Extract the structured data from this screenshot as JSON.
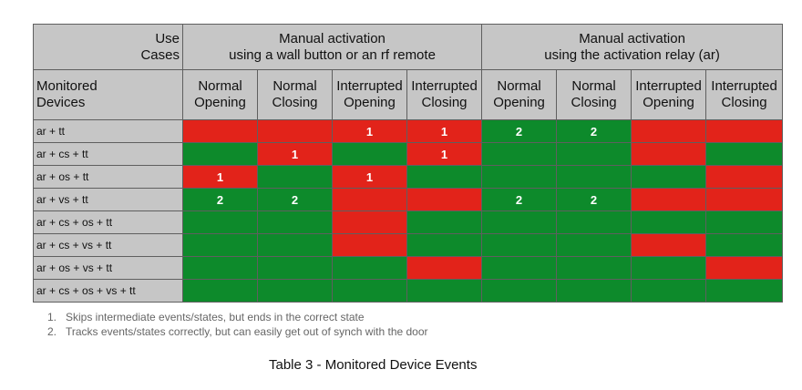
{
  "header": {
    "use_cases_line1": "Use",
    "use_cases_line2": "Cases",
    "group1_line1": "Manual activation",
    "group1_line2": "using a wall button or an rf remote",
    "group2_line1": "Manual activation",
    "group2_line2": "using the activation relay (ar)",
    "monitored_line1": "Monitored",
    "monitored_line2": "Devices",
    "columns": [
      {
        "line1": "Normal",
        "line2": "Opening"
      },
      {
        "line1": "Normal",
        "line2": "Closing"
      },
      {
        "line1": "Interrupted",
        "line2": "Opening"
      },
      {
        "line1": "Interrupted",
        "line2": "Closing"
      },
      {
        "line1": "Normal",
        "line2": "Opening"
      },
      {
        "line1": "Normal",
        "line2": "Closing"
      },
      {
        "line1": "Interrupted",
        "line2": "Opening"
      },
      {
        "line1": "Interrupted",
        "line2": "Closing"
      }
    ]
  },
  "colors": {
    "red": "#e2231a",
    "green": "#0d8a2b",
    "header": "#c6c6c6"
  },
  "rows": [
    {
      "label": "ar + tt",
      "cells": [
        {
          "s": "red",
          "t": ""
        },
        {
          "s": "red",
          "t": ""
        },
        {
          "s": "red",
          "t": "1"
        },
        {
          "s": "red",
          "t": "1"
        },
        {
          "s": "green",
          "t": "2"
        },
        {
          "s": "green",
          "t": "2"
        },
        {
          "s": "red",
          "t": ""
        },
        {
          "s": "red",
          "t": ""
        }
      ]
    },
    {
      "label": "ar + cs + tt",
      "cells": [
        {
          "s": "green",
          "t": ""
        },
        {
          "s": "red",
          "t": "1"
        },
        {
          "s": "green",
          "t": ""
        },
        {
          "s": "red",
          "t": "1"
        },
        {
          "s": "green",
          "t": ""
        },
        {
          "s": "green",
          "t": ""
        },
        {
          "s": "red",
          "t": ""
        },
        {
          "s": "green",
          "t": ""
        }
      ]
    },
    {
      "label": "ar + os + tt",
      "cells": [
        {
          "s": "red",
          "t": "1"
        },
        {
          "s": "green",
          "t": ""
        },
        {
          "s": "red",
          "t": "1"
        },
        {
          "s": "green",
          "t": ""
        },
        {
          "s": "green",
          "t": ""
        },
        {
          "s": "green",
          "t": ""
        },
        {
          "s": "green",
          "t": ""
        },
        {
          "s": "red",
          "t": ""
        }
      ]
    },
    {
      "label": "ar + vs + tt",
      "cells": [
        {
          "s": "green",
          "t": "2"
        },
        {
          "s": "green",
          "t": "2"
        },
        {
          "s": "red",
          "t": ""
        },
        {
          "s": "red",
          "t": ""
        },
        {
          "s": "green",
          "t": "2"
        },
        {
          "s": "green",
          "t": "2"
        },
        {
          "s": "red",
          "t": ""
        },
        {
          "s": "red",
          "t": ""
        }
      ]
    },
    {
      "label": "ar + cs + os + tt",
      "cells": [
        {
          "s": "green",
          "t": ""
        },
        {
          "s": "green",
          "t": ""
        },
        {
          "s": "red",
          "t": ""
        },
        {
          "s": "green",
          "t": ""
        },
        {
          "s": "green",
          "t": ""
        },
        {
          "s": "green",
          "t": ""
        },
        {
          "s": "green",
          "t": ""
        },
        {
          "s": "green",
          "t": ""
        }
      ]
    },
    {
      "label": "ar + cs + vs + tt",
      "cells": [
        {
          "s": "green",
          "t": ""
        },
        {
          "s": "green",
          "t": ""
        },
        {
          "s": "red",
          "t": ""
        },
        {
          "s": "green",
          "t": ""
        },
        {
          "s": "green",
          "t": ""
        },
        {
          "s": "green",
          "t": ""
        },
        {
          "s": "red",
          "t": ""
        },
        {
          "s": "green",
          "t": ""
        }
      ]
    },
    {
      "label": "ar + os + vs + tt",
      "cells": [
        {
          "s": "green",
          "t": ""
        },
        {
          "s": "green",
          "t": ""
        },
        {
          "s": "green",
          "t": ""
        },
        {
          "s": "red",
          "t": ""
        },
        {
          "s": "green",
          "t": ""
        },
        {
          "s": "green",
          "t": ""
        },
        {
          "s": "green",
          "t": ""
        },
        {
          "s": "red",
          "t": ""
        }
      ]
    },
    {
      "label": "ar + cs + os + vs + tt",
      "cells": [
        {
          "s": "green",
          "t": ""
        },
        {
          "s": "green",
          "t": ""
        },
        {
          "s": "green",
          "t": ""
        },
        {
          "s": "green",
          "t": ""
        },
        {
          "s": "green",
          "t": ""
        },
        {
          "s": "green",
          "t": ""
        },
        {
          "s": "green",
          "t": ""
        },
        {
          "s": "green",
          "t": ""
        }
      ]
    }
  ],
  "notes": [
    {
      "num": "1.",
      "text": "Skips intermediate events/states, but ends in the correct state"
    },
    {
      "num": "2.",
      "text": "Tracks events/states correctly, but can easily get out of synch with the door"
    }
  ],
  "caption": "Table 3 - Monitored Device Events"
}
